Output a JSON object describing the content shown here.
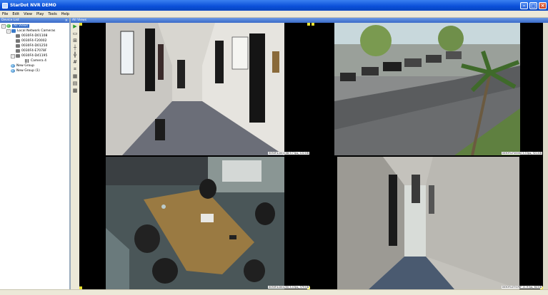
{
  "window": {
    "title": "StarDot NVR DEMO"
  },
  "menu": [
    "File",
    "Edit",
    "View",
    "Play",
    "Tools",
    "Help"
  ],
  "left_panel": {
    "header": "Device List",
    "tree": {
      "root": "All Views",
      "network": "Local Network Cameras",
      "cameras": [
        "0030F4-D01108",
        "0030F4-F20002",
        "0030F4-D01250",
        "0030F4-E7078F",
        "0030F4-D41195"
      ],
      "sub_camera": "Camera 4",
      "groups": [
        "New Group",
        "New Group (1)"
      ]
    }
  },
  "view_header": "All Views",
  "cameras": [
    {
      "caption": "0030F4-D01108  9.7 fps, 122 KB"
    },
    {
      "caption": "0030F4-F20002  5.3 fps, 321 KB"
    },
    {
      "caption": "0030F4-D01250  5.4 fps, 379 KB"
    },
    {
      "caption": "0030F4-E7078F  11.9 fps, 64 KB"
    }
  ],
  "colors": {
    "accent": "#316ac5",
    "title_bar": "#0a4fd8",
    "marker": "#e8e030"
  }
}
